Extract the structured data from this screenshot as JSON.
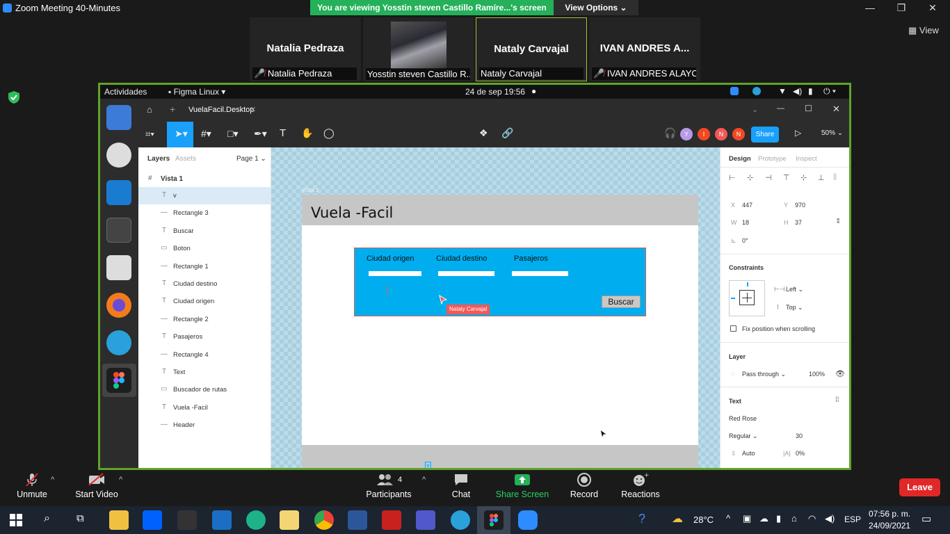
{
  "zoom": {
    "title": "Zoom Meeting 40-Minutes",
    "share_banner": "You are viewing Yosstin steven Castillo Ramíre...'s screen",
    "view_options": "View Options",
    "view_label": "View",
    "participants": [
      {
        "big": "Natalia Pedraza",
        "small": "Natalia Pedraza"
      },
      {
        "big": "",
        "small": "Yosstin steven Castillo R..."
      },
      {
        "big": "Nataly Carvajal",
        "small": "Nataly Carvajal"
      },
      {
        "big": "IVAN ANDRES A...",
        "small": "IVAN ANDRES ALAYO..."
      }
    ],
    "bottom": {
      "unmute": "Unmute",
      "start_video": "Start Video",
      "participants": "Participants",
      "participants_count": "4",
      "chat": "Chat",
      "share_screen": "Share Screen",
      "record": "Record",
      "reactions": "Reactions",
      "leave": "Leave"
    },
    "colors": {
      "share_green": "#25b05a",
      "frame_green": "#5fa32a",
      "leave_red": "#e02828"
    }
  },
  "ubuntu": {
    "activities": "Actividades",
    "app_menu": "Figma Linux",
    "clock": "24 de sep  19:56"
  },
  "figma": {
    "tab_title": "VuelaFacil.Desktop",
    "share_label": "Share",
    "zoom_level": "50%",
    "avatars": [
      "Y",
      "I",
      "N",
      "N"
    ],
    "layers_tab": "Layers",
    "assets_tab": "Assets",
    "page": "Page 1",
    "frame_name": "Vista 1",
    "layers": [
      {
        "icon": "T",
        "name": "v"
      },
      {
        "icon": "—",
        "name": "Rectangle 3"
      },
      {
        "icon": "T",
        "name": "Buscar"
      },
      {
        "icon": "▭",
        "name": "Boton"
      },
      {
        "icon": "—",
        "name": "Rectangle 1"
      },
      {
        "icon": "T",
        "name": "Ciudad destino"
      },
      {
        "icon": "T",
        "name": "Ciudad origen"
      },
      {
        "icon": "—",
        "name": "Rectangle 2"
      },
      {
        "icon": "T",
        "name": "Pasajeros"
      },
      {
        "icon": "—",
        "name": "Rectangle 4"
      },
      {
        "icon": "T",
        "name": "Text"
      },
      {
        "icon": "▭",
        "name": "Buscador de rutas"
      },
      {
        "icon": "T",
        "name": "Vuela -Facil"
      },
      {
        "icon": "—",
        "name": "Header"
      }
    ],
    "canvas": {
      "frame_label": "Vista 1",
      "header_title": "Vuela -Facil",
      "field_labels": [
        "Ciudad origen",
        "Ciudad destino",
        "Pasajeros"
      ],
      "button": "Buscar",
      "cursor_user": "Nataly Carvajal",
      "selected_text": "v"
    },
    "design": {
      "tabs": [
        "Design",
        "Prototype",
        "Inspect"
      ],
      "x_label": "X",
      "x": "447",
      "y_label": "Y",
      "y": "970",
      "w_label": "W",
      "w": "18",
      "h_label": "H",
      "h": "37",
      "rotation": "0°",
      "constraints_title": "Constraints",
      "constraint_h": "Left",
      "constraint_v": "Top",
      "fix_position": "Fix position when scrolling",
      "layer_title": "Layer",
      "blend": "Pass through",
      "opacity": "100%",
      "text_title": "Text",
      "font": "Red Rose",
      "weight": "Regular",
      "size": "30",
      "line_height": "Auto",
      "letter_spacing": "0%"
    }
  },
  "taskbar": {
    "temperature": "28°C",
    "lang": "ESP",
    "time": "07:56 p. m.",
    "date": "24/09/2021"
  }
}
